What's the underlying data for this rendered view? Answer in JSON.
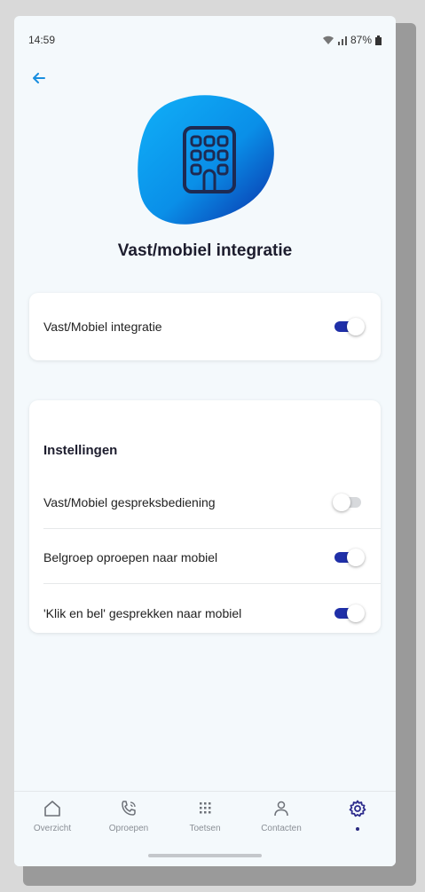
{
  "status_bar": {
    "time": "14:59",
    "battery": "87%"
  },
  "page": {
    "title": "Vast/mobiel integratie"
  },
  "main_card": {
    "label": "Vast/Mobiel integratie",
    "enabled": true
  },
  "settings": {
    "title": "Instellingen",
    "items": [
      {
        "label": "Vast/Mobiel gespreksbediening",
        "enabled": false
      },
      {
        "label": "Belgroep oproepen naar mobiel",
        "enabled": true
      },
      {
        "label": "'Klik en bel' gesprekken naar mobiel",
        "enabled": true
      }
    ]
  },
  "bottom_nav": {
    "items": [
      {
        "label": "Overzicht",
        "icon": "home-icon"
      },
      {
        "label": "Oproepen",
        "icon": "phone-icon"
      },
      {
        "label": "Toetsen",
        "icon": "keypad-icon"
      },
      {
        "label": "Contacten",
        "icon": "person-icon"
      },
      {
        "label": "",
        "icon": "gear-icon",
        "active": true
      }
    ]
  },
  "colors": {
    "accent": "#1f2fa8",
    "hero_blob": "#0a9ef0",
    "background": "#f4f9fc"
  }
}
